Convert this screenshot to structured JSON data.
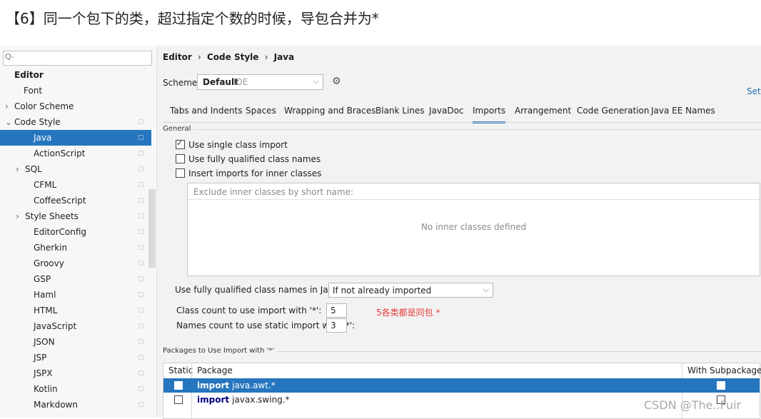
{
  "heading": "【6】同一个包下的类，超过指定个数的时候，导包合并为*",
  "sidebar": {
    "search_icon": "Q-",
    "items": [
      {
        "label": "Editor"
      },
      {
        "label": "Font"
      },
      {
        "label": "Color Scheme",
        "arrow": "›"
      },
      {
        "label": "Code Style",
        "arrow": "⌄"
      },
      {
        "label": "Java"
      },
      {
        "label": "ActionScript"
      },
      {
        "label": "SQL",
        "arrow": "›"
      },
      {
        "label": "CFML"
      },
      {
        "label": "CoffeeScript"
      },
      {
        "label": "Style Sheets",
        "arrow": "›"
      },
      {
        "label": "EditorConfig"
      },
      {
        "label": "Gherkin"
      },
      {
        "label": "Groovy"
      },
      {
        "label": "GSP"
      },
      {
        "label": "Haml"
      },
      {
        "label": "HTML"
      },
      {
        "label": "JavaScript"
      },
      {
        "label": "JSON"
      },
      {
        "label": "JSP"
      },
      {
        "label": "JSPX"
      },
      {
        "label": "Kotlin"
      },
      {
        "label": "Markdown"
      }
    ]
  },
  "breadcrumb": {
    "part1": "Editor",
    "sep": "›",
    "part2": "Code Style",
    "part3": "Java"
  },
  "scheme": {
    "label": "Scheme:",
    "name": "Default",
    "sub": "IDE",
    "set_link": "Set"
  },
  "tabs": [
    {
      "label": "Tabs and Indents"
    },
    {
      "label": "Spaces"
    },
    {
      "label": "Wrapping and Braces"
    },
    {
      "label": "Blank Lines"
    },
    {
      "label": "JavaDoc"
    },
    {
      "label": "Imports"
    },
    {
      "label": "Arrangement"
    },
    {
      "label": "Code Generation"
    },
    {
      "label": "Java EE Names"
    }
  ],
  "active_tab": "Imports",
  "general": {
    "title": "General",
    "single_class_import": {
      "label": "Use single class import",
      "checked": true
    },
    "fully_qualified": {
      "label": "Use fully qualified class names",
      "checked": false
    },
    "inner_classes": {
      "label": "Insert imports for inner classes",
      "checked": false
    },
    "exclude_placeholder": "Exclude inner classes by short name:",
    "exclude_empty": "No inner classes defined"
  },
  "javadoc": {
    "label": "Use fully qualified class names in JavaDoc:",
    "value": "If not already imported"
  },
  "class_count": {
    "label": "Class count to use import with '*':",
    "value": "5"
  },
  "names_count": {
    "label": "Names count to use static import with '*':",
    "value": "3"
  },
  "annotation_note": "5各类都是同包 *",
  "packages": {
    "title": "Packages to Use Import with '*'",
    "col_static": "Static",
    "col_package": "Package",
    "col_sub": "With Subpackages",
    "rows": [
      {
        "keyword": "import",
        "name": "java.awt.*",
        "static": false,
        "sub": false
      },
      {
        "keyword": "import",
        "name": "javax.swing.*",
        "static": false,
        "sub": false
      }
    ]
  },
  "watermark": "CSDN @The..Fuir",
  "colors": {
    "selection": "#2675bf",
    "note": "#e53935",
    "link": "#2470b3"
  }
}
